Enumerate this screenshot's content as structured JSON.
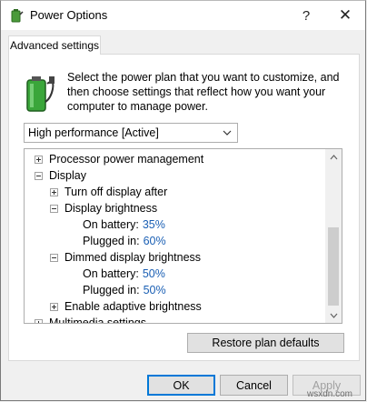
{
  "window": {
    "title": "Power Options",
    "help_label": "?",
    "close_label": "✕"
  },
  "tab": {
    "label": "Advanced settings"
  },
  "description": "Select the power plan that you want to customize, and then choose settings that reflect how you want your computer to manage power.",
  "plan_select": {
    "value": "High performance [Active]"
  },
  "tree": {
    "rows": [
      {
        "label": "Processor power management"
      },
      {
        "label": "Display"
      },
      {
        "label": "Turn off display after"
      },
      {
        "label": "Display brightness"
      },
      {
        "label": "On battery:",
        "value": "35%"
      },
      {
        "label": "Plugged in:",
        "value": "60%"
      },
      {
        "label": "Dimmed display brightness"
      },
      {
        "label": "On battery:",
        "value": "50%"
      },
      {
        "label": "Plugged in:",
        "value": "50%"
      },
      {
        "label": "Enable adaptive brightness"
      },
      {
        "label": "Multimedia settings"
      }
    ]
  },
  "buttons": {
    "restore": "Restore plan defaults",
    "ok": "OK",
    "cancel": "Cancel",
    "apply": "Apply"
  },
  "watermark": "wsxdn.com",
  "colors": {
    "value_text": "#1a5fb4",
    "ok_border": "#0078d7"
  },
  "icons": [
    "power-options-icon",
    "help-icon",
    "close-icon",
    "battery-plug-icon",
    "chevron-down-icon",
    "scroll-up-icon",
    "scroll-down-icon",
    "plus-expander-icon",
    "minus-expander-icon"
  ]
}
